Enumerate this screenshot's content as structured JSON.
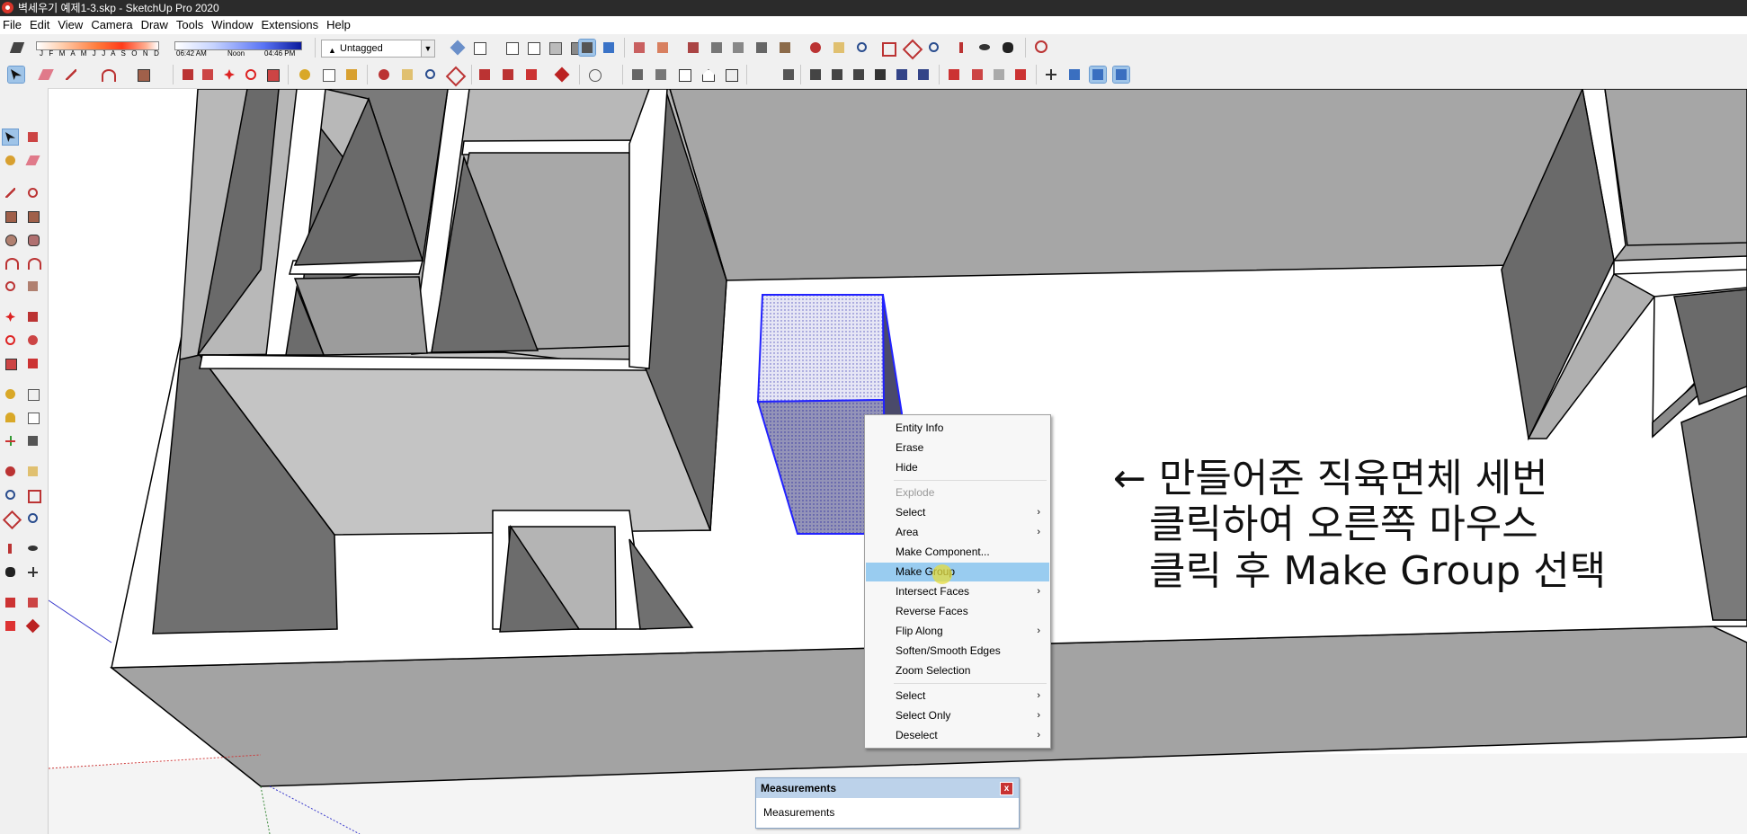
{
  "window": {
    "title": "벽세우기 예제1-3.skp - SketchUp Pro 2020"
  },
  "menu": [
    "File",
    "Edit",
    "View",
    "Camera",
    "Draw",
    "Tools",
    "Window",
    "Extensions",
    "Help"
  ],
  "shadow_settings": {
    "months": "J F M A M J J A S O N D",
    "time_start": "06:42 AM",
    "time_noon": "Noon",
    "time_end": "04:46 PM"
  },
  "tag_selector": {
    "value": "Untagged"
  },
  "context_menu": {
    "items": [
      {
        "label": "Entity Info",
        "submenu": false,
        "disabled": false
      },
      {
        "label": "Erase",
        "submenu": false,
        "disabled": false
      },
      {
        "label": "Hide",
        "submenu": false,
        "disabled": false
      },
      {
        "label": "Explode",
        "submenu": false,
        "disabled": true
      },
      {
        "label": "Select",
        "submenu": true,
        "disabled": false
      },
      {
        "label": "Area",
        "submenu": true,
        "disabled": false
      },
      {
        "label": "Make Component...",
        "submenu": false,
        "disabled": false
      },
      {
        "label": "Make Group",
        "submenu": false,
        "disabled": false,
        "highlighted": true
      },
      {
        "label": "Intersect Faces",
        "submenu": true,
        "disabled": false
      },
      {
        "label": "Reverse Faces",
        "submenu": false,
        "disabled": false
      },
      {
        "label": "Flip Along",
        "submenu": true,
        "disabled": false
      },
      {
        "label": "Soften/Smooth Edges",
        "submenu": false,
        "disabled": false
      },
      {
        "label": "Zoom Selection",
        "submenu": false,
        "disabled": false
      },
      {
        "label": "Select",
        "submenu": true,
        "disabled": false
      },
      {
        "label": "Select Only",
        "submenu": true,
        "disabled": false
      },
      {
        "label": "Deselect",
        "submenu": true,
        "disabled": false
      }
    ],
    "submenu_glyph": "›"
  },
  "annotation": {
    "line1": "← 만들어준 직육면체 세번",
    "line2": "클릭하여 오른쪽 마우스",
    "line3": "클릭 후 Make Group 선택"
  },
  "measurements": {
    "title": "Measurements",
    "label": "Measurements",
    "close": "x"
  },
  "colors": {
    "selection_blue": "#2222ff",
    "menu_highlight": "#99ccf0",
    "wall_dark": "#6e6e6e",
    "wall_mid": "#a6a6a6",
    "wall_light": "#c8c8c8",
    "floor": "#ffffff",
    "title_bar": "#2b2b2b"
  }
}
